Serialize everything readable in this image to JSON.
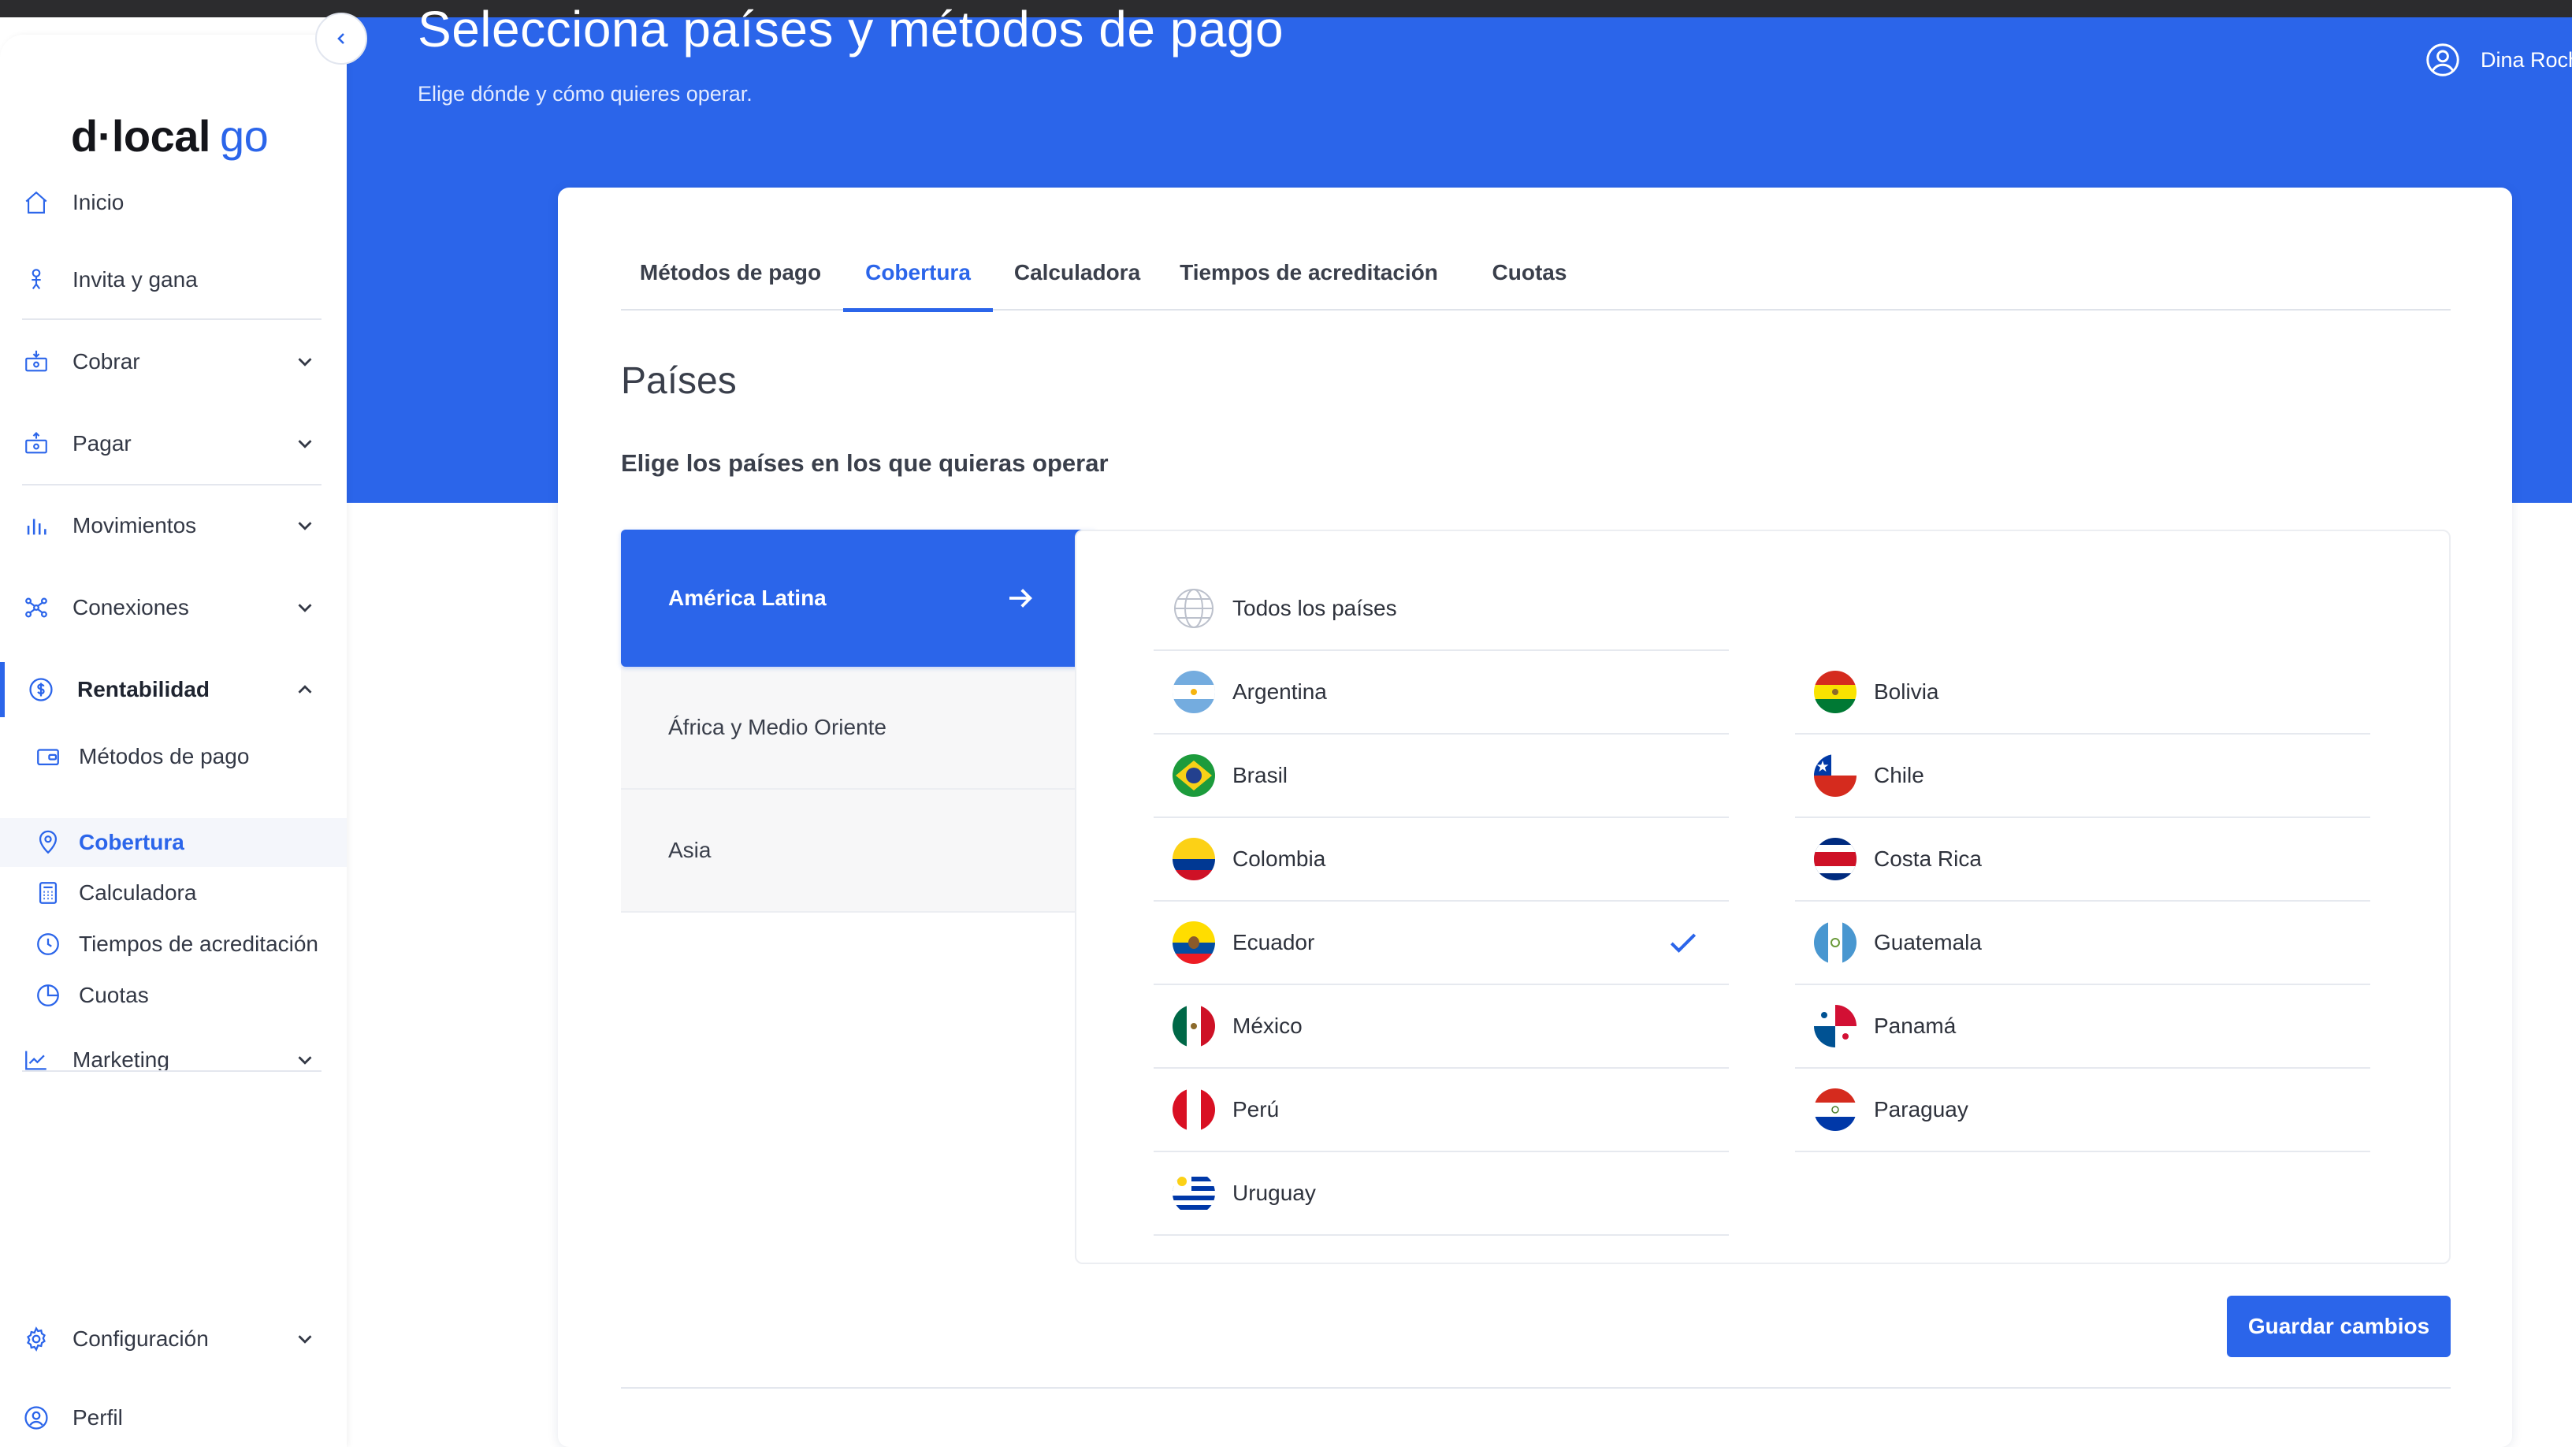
{
  "header": {
    "title": "Selecciona países y métodos de pago",
    "subtitle": "Elige dónde y cómo quieres operar.",
    "user_name": "Dina Roch"
  },
  "brand": {
    "logo_main": "d·local",
    "logo_suffix": "go",
    "accent": "#2b65ea"
  },
  "sidebar": {
    "items": [
      {
        "label": "Inicio",
        "icon": "home-icon"
      },
      {
        "label": "Invita y gana",
        "icon": "gift-icon"
      },
      {
        "label": "Cobrar",
        "icon": "cash-in-icon"
      },
      {
        "label": "Pagar",
        "icon": "cash-out-icon"
      },
      {
        "label": "Movimientos",
        "icon": "bar-chart-icon"
      },
      {
        "label": "Conexiones",
        "icon": "connections-icon"
      },
      {
        "label": "Rentabilidad",
        "icon": "dollar-circle-icon"
      },
      {
        "label": "Marketing",
        "icon": "trend-chart-icon"
      },
      {
        "label": "Configuración",
        "icon": "gear-icon"
      },
      {
        "label": "Perfil",
        "icon": "user-circle-icon"
      }
    ],
    "rentabilidad_sub": [
      {
        "label": "Métodos de pago",
        "icon": "wallet-icon"
      },
      {
        "label": "Cobertura",
        "icon": "location-pin-icon"
      },
      {
        "label": "Calculadora",
        "icon": "calculator-icon"
      },
      {
        "label": "Tiempos de acreditación",
        "icon": "clock-icon"
      },
      {
        "label": "Cuotas",
        "icon": "pie-chart-icon"
      }
    ]
  },
  "tabs": [
    {
      "label": "Métodos de pago"
    },
    {
      "label": "Cobertura"
    },
    {
      "label": "Calculadora"
    },
    {
      "label": "Tiempos de acreditación"
    },
    {
      "label": "Cuotas"
    }
  ],
  "active_tab": "Cobertura",
  "section": {
    "title": "Países",
    "description": "Elige los países en los que quieras operar"
  },
  "regions": [
    {
      "label": "América Latina"
    },
    {
      "label": "África y Medio Oriente"
    },
    {
      "label": "Asia"
    }
  ],
  "active_region": "América Latina",
  "all_countries_label": "Todos los países",
  "countries": [
    {
      "name": "Argentina",
      "selected": false
    },
    {
      "name": "Bolivia",
      "selected": false
    },
    {
      "name": "Brasil",
      "selected": false
    },
    {
      "name": "Chile",
      "selected": false
    },
    {
      "name": "Colombia",
      "selected": false
    },
    {
      "name": "Costa Rica",
      "selected": false
    },
    {
      "name": "Ecuador",
      "selected": true
    },
    {
      "name": "Guatemala",
      "selected": false
    },
    {
      "name": "México",
      "selected": false
    },
    {
      "name": "Panamá",
      "selected": false
    },
    {
      "name": "Perú",
      "selected": false
    },
    {
      "name": "Paraguay",
      "selected": false
    },
    {
      "name": "Uruguay",
      "selected": false
    }
  ],
  "save_button": "Guardar cambios"
}
